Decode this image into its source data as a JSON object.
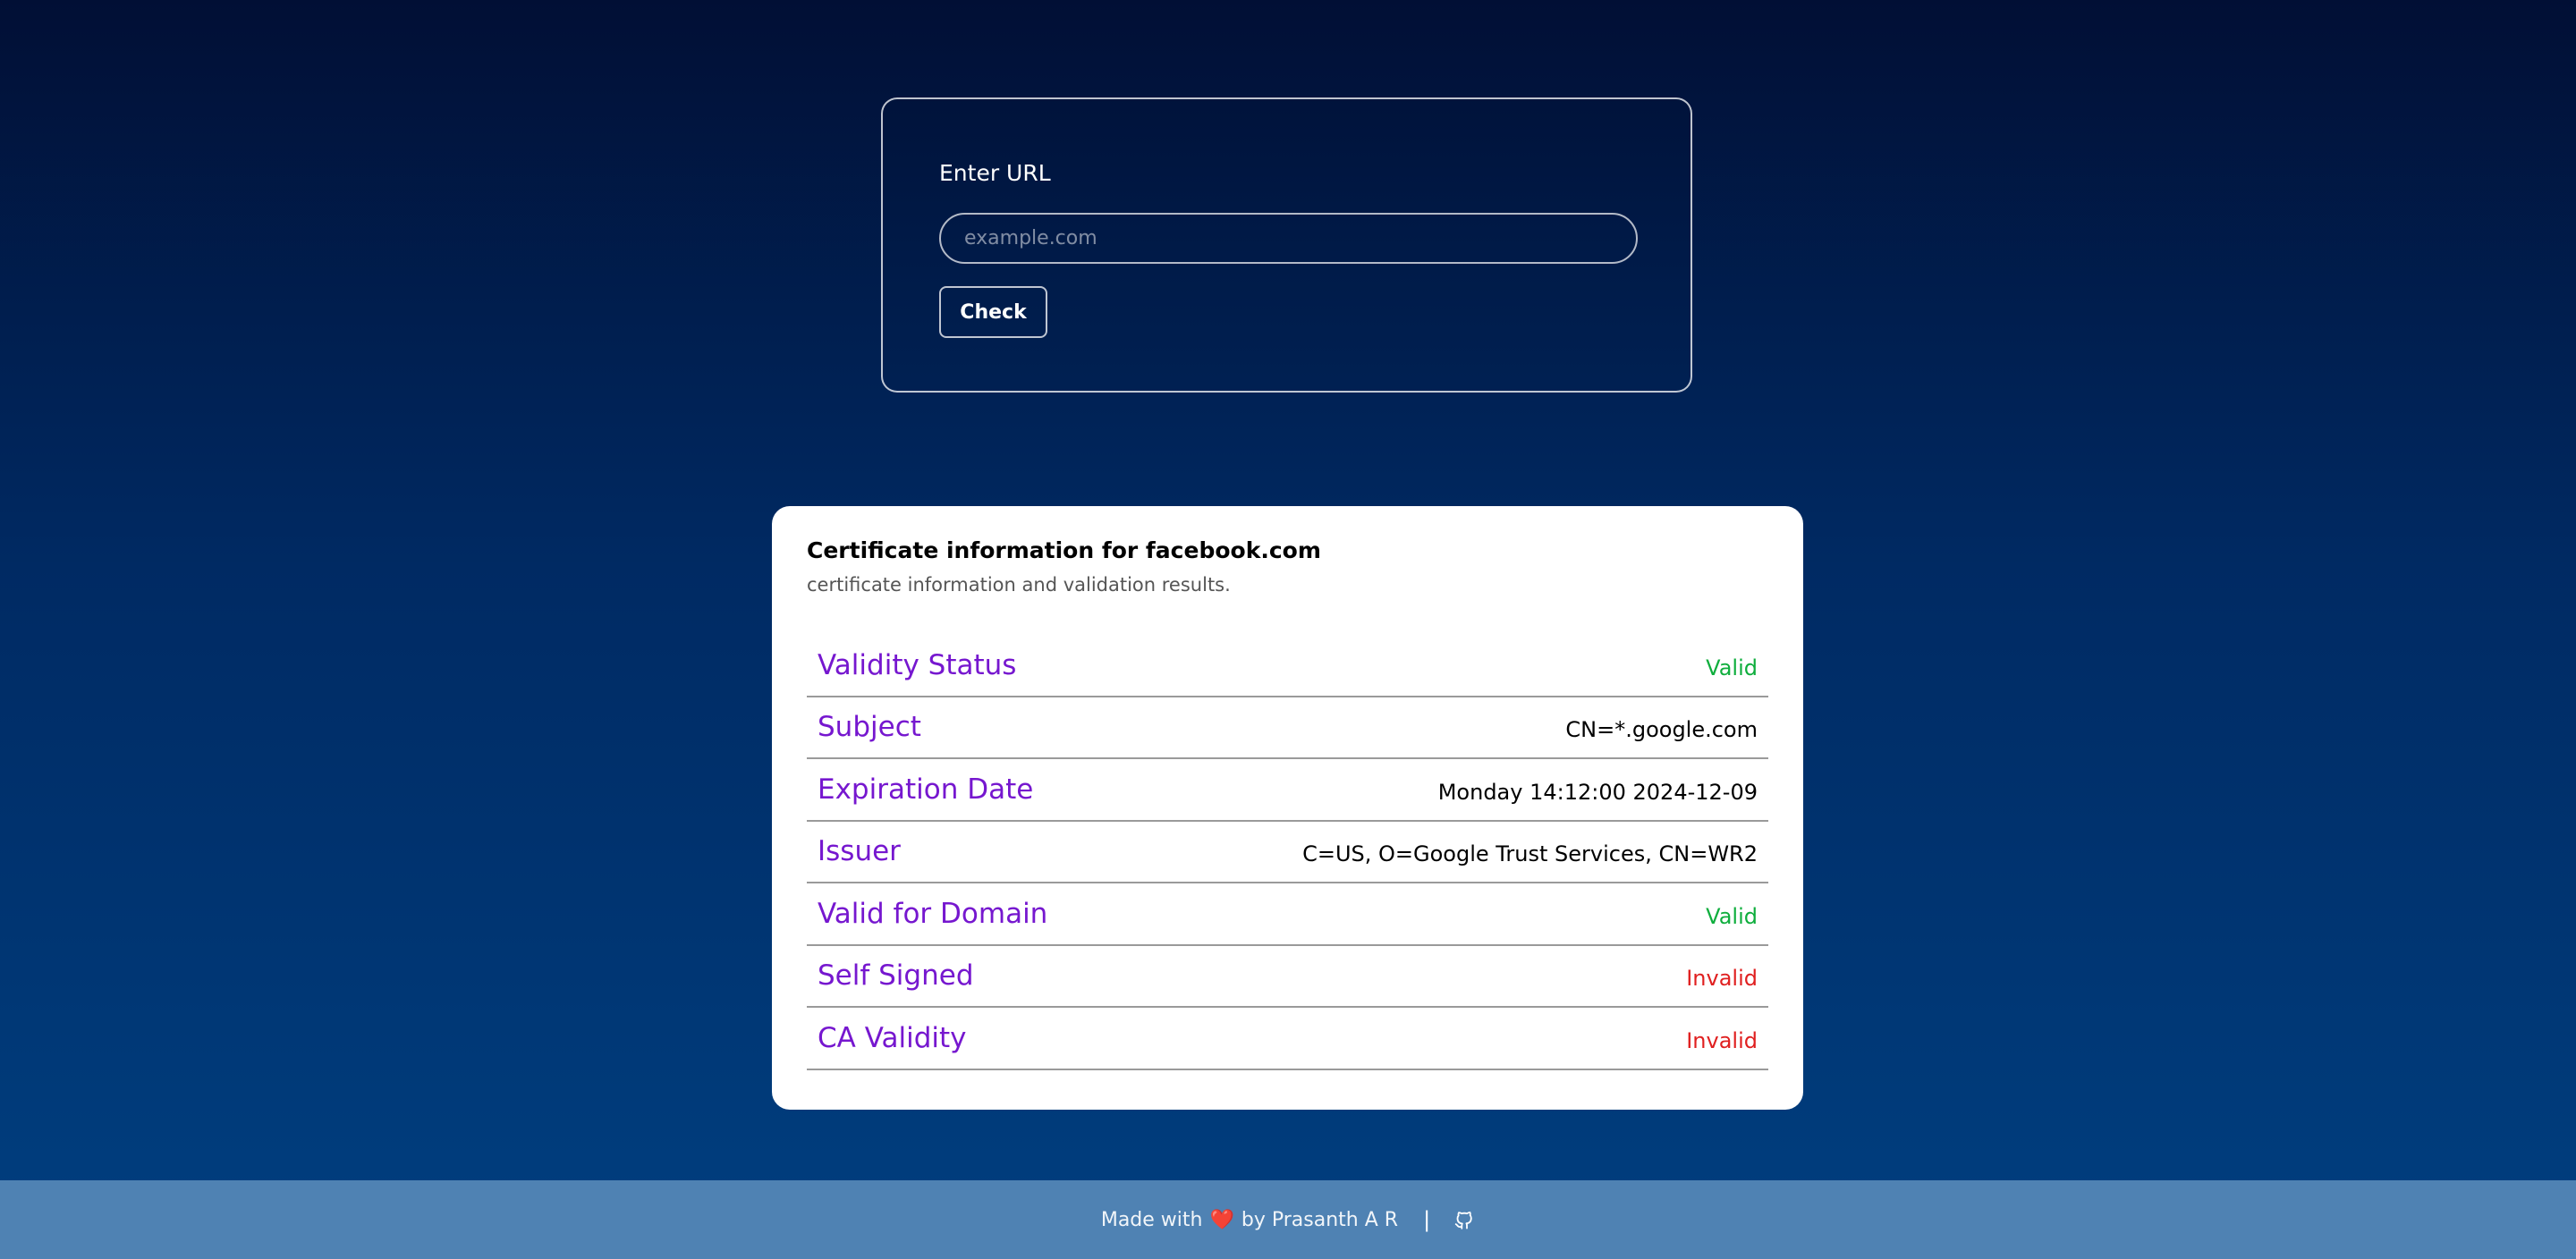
{
  "url_form": {
    "label": "Enter URL",
    "input_value": "",
    "input_placeholder": "example.com",
    "check_label": "Check"
  },
  "result": {
    "title": "Certificate information for facebook.com",
    "subtitle": "certificate information and validation results.",
    "rows": [
      {
        "label": "Validity Status",
        "value": "Valid",
        "status": "valid"
      },
      {
        "label": "Subject",
        "value": "CN=*.google.com",
        "status": "neutral"
      },
      {
        "label": "Expiration Date",
        "value": "Monday 14:12:00 2024-12-09",
        "status": "neutral"
      },
      {
        "label": "Issuer",
        "value": "C=US, O=Google Trust Services, CN=WR2",
        "status": "neutral"
      },
      {
        "label": "Valid for Domain",
        "value": "Valid",
        "status": "valid"
      },
      {
        "label": "Self Signed",
        "value": "Invalid",
        "status": "invalid"
      },
      {
        "label": "CA Validity",
        "value": "Invalid",
        "status": "invalid"
      }
    ]
  },
  "footer": {
    "made_with": "Made with",
    "heart": "❤️",
    "by": "by Prasanth A R",
    "separator": "|",
    "github_icon": "github-icon"
  },
  "colors": {
    "accent_label": "#7617cf",
    "valid": "#0fae3d",
    "invalid": "#e02020",
    "footer_bg": "#4f82b3"
  }
}
